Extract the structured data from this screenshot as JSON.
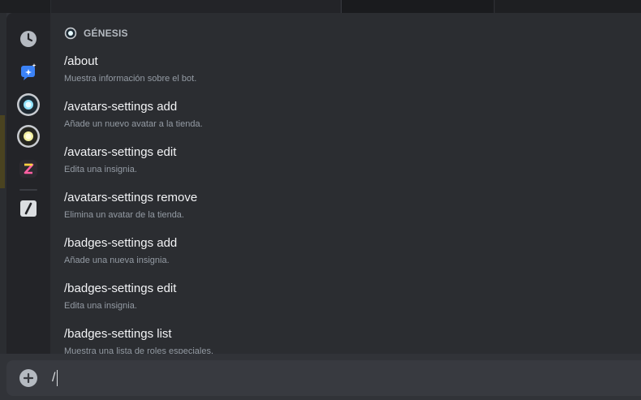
{
  "section": {
    "title": "GÉNESIS"
  },
  "commands": [
    {
      "name": "/about",
      "description": "Muestra información sobre el bot."
    },
    {
      "name": "/avatars-settings add",
      "description": "Añade un nuevo avatar a la tienda."
    },
    {
      "name": "/avatars-settings edit",
      "description": "Edita una insignia."
    },
    {
      "name": "/avatars-settings remove",
      "description": "Elimina un avatar de la tienda."
    },
    {
      "name": "/badges-settings add",
      "description": "Añade una nueva insignia."
    },
    {
      "name": "/badges-settings edit",
      "description": "Edita una insignia."
    },
    {
      "name": "/badges-settings list",
      "description": "Muestra una lista de roles especiales."
    }
  ],
  "rail_icons": [
    "clock-icon",
    "sparkle-app-icon",
    "genesis-bot-icon",
    "yellow-bot-icon",
    "z-bot-icon",
    "slash-commands-icon"
  ],
  "composer": {
    "value": "/"
  },
  "colors": {
    "background": "#313338",
    "panel": "#2b2d31",
    "rail": "#232428",
    "composer": "#383a40",
    "accent_blue": "#5865f2"
  }
}
